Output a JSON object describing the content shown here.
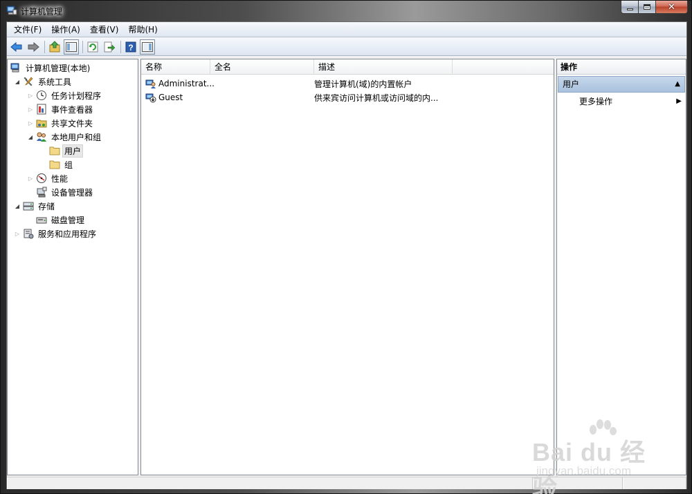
{
  "window": {
    "title": "计算机管理"
  },
  "menu": [
    "文件(F)",
    "操作(A)",
    "查看(V)",
    "帮助(H)"
  ],
  "toolbar": {
    "buttons": [
      "back-icon",
      "forward-icon",
      "up-icon",
      "show-hide-tree-icon",
      "refresh-icon",
      "export-icon",
      "help-icon",
      "show-hide-action-icon"
    ]
  },
  "tree": {
    "root": "计算机管理(本地)",
    "system_tools": "系统工具",
    "task_scheduler": "任务计划程序",
    "event_viewer": "事件查看器",
    "shared_folders": "共享文件夹",
    "local_users_groups": "本地用户和组",
    "users": "用户",
    "groups": "组",
    "performance": "性能",
    "device_manager": "设备管理器",
    "storage": "存储",
    "disk_management": "磁盘管理",
    "services_apps": "服务和应用程序"
  },
  "list": {
    "columns": [
      "名称",
      "全名",
      "描述"
    ],
    "rows": [
      {
        "name": "Administrat...",
        "fullname": "",
        "description": "管理计算机(域)的内置帐户"
      },
      {
        "name": "Guest",
        "fullname": "",
        "description": "供来宾访问计算机或访问域的内..."
      }
    ]
  },
  "actions": {
    "header": "操作",
    "section": "用户",
    "more": "更多操作"
  },
  "watermark": {
    "logo": "Bai du 经验",
    "sub": "jingyan.baidu.com"
  }
}
